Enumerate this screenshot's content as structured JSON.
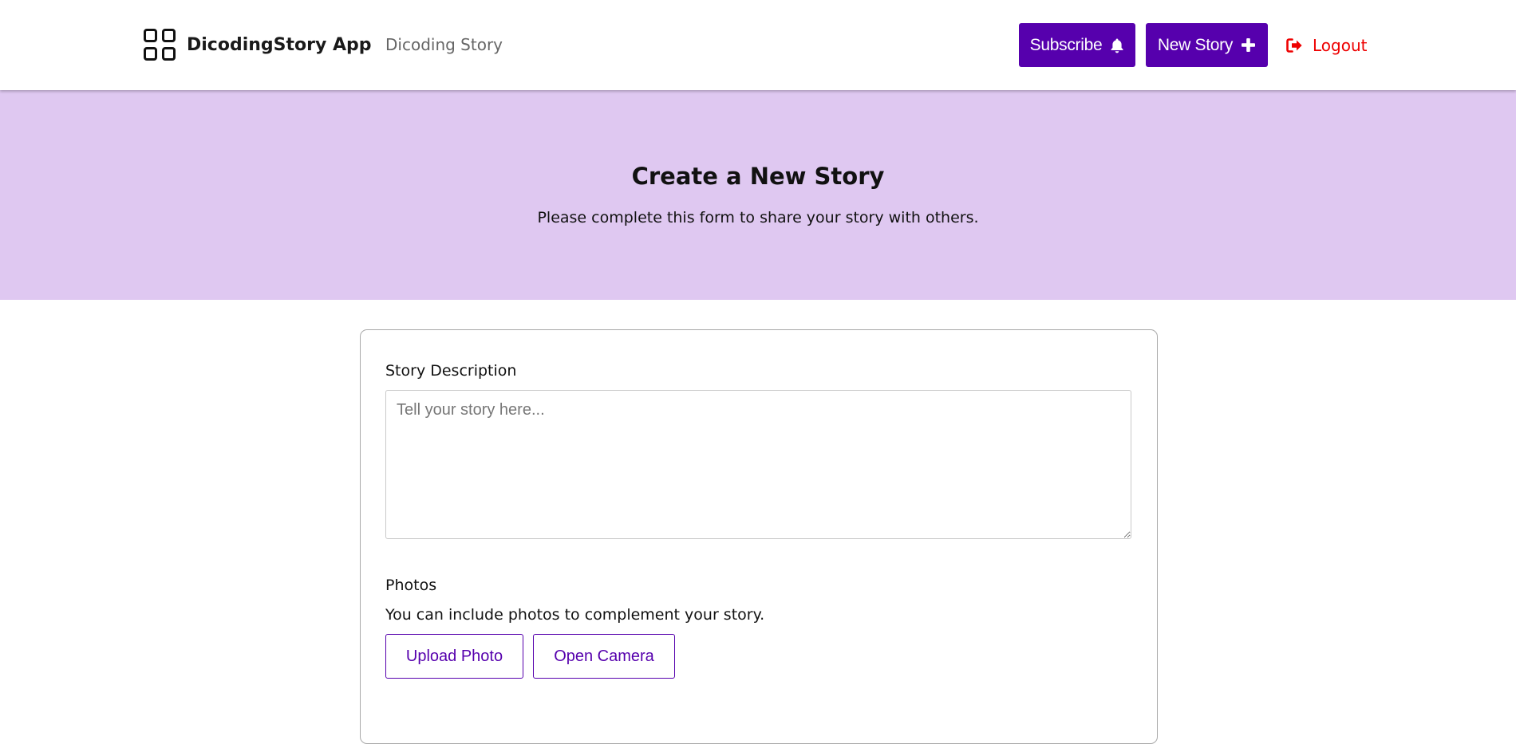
{
  "header": {
    "brand_name": "DicodingStory App",
    "brand_icon": "grid-icon",
    "nav_link": "Dicoding Story",
    "subscribe_label": "Subscribe",
    "subscribe_icon": "bell-icon",
    "new_story_label": "New Story",
    "new_story_icon": "plus-icon",
    "logout_label": "Logout",
    "logout_icon": "sign-out-icon"
  },
  "hero": {
    "title": "Create a New Story",
    "subtitle": "Please complete this form to share your story with others."
  },
  "form": {
    "description_label": "Story Description",
    "description_placeholder": "Tell your story here...",
    "description_value": "",
    "photos_label": "Photos",
    "photos_help": "You can include photos to complement your story.",
    "upload_label": "Upload Photo",
    "camera_label": "Open Camera"
  },
  "colors": {
    "primary": "#5600ad",
    "hero_background": "#dfc8f1",
    "logout": "#ee0000",
    "nav_link": "#666666"
  }
}
